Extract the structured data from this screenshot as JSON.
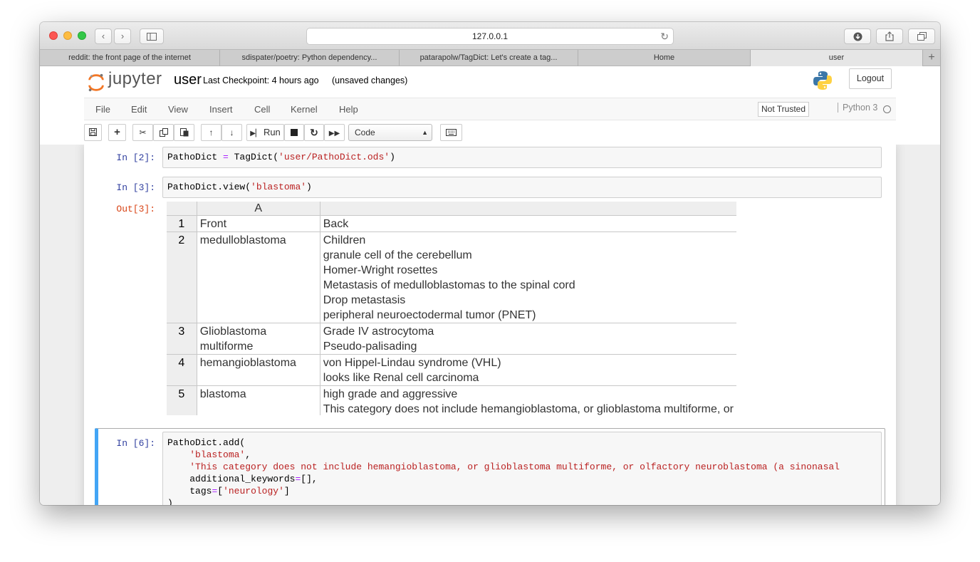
{
  "browser": {
    "url": "127.0.0.1",
    "tabs": [
      {
        "label": "reddit: the front page of the internet"
      },
      {
        "label": "sdispater/poetry: Python dependency..."
      },
      {
        "label": "patarapolw/TagDict: Let's create a tag..."
      },
      {
        "label": "Home"
      },
      {
        "label": "user"
      }
    ]
  },
  "jupyter": {
    "logo_text": "jupyter",
    "notebook_name": "user",
    "checkpoint": "Last Checkpoint: 4 hours ago",
    "unsaved": "(unsaved changes)",
    "logout": "Logout",
    "menu": [
      "File",
      "Edit",
      "View",
      "Insert",
      "Cell",
      "Kernel",
      "Help"
    ],
    "trust": "Not Trusted",
    "kernel_name": "Python 3",
    "run_label": "Run",
    "cell_type": "Code"
  },
  "cells": {
    "c2": {
      "prompt": "In [2]:",
      "code": {
        "a": "PathoDict ",
        "b": "=",
        "c": " TagDict(",
        "d": "'user/PathoDict.ods'",
        "e": ")"
      }
    },
    "c3": {
      "prompt": "In [3]:",
      "code": {
        "a": "PathoDict.view(",
        "b": "'blastoma'",
        "c": ")"
      },
      "out_prompt": "Out[3]:"
    },
    "c6": {
      "prompt": "In [6]:",
      "lines": {
        "l1": "PathoDict.add(",
        "l2": "'blastoma'",
        "l2b": ",",
        "l3": "'This category does not include hemangioblastoma, or glioblastoma multiforme, or olfactory neuroblastoma (a sinonasal",
        "l4a": "additional_keywords",
        "l4b": "=",
        "l4c": "[],",
        "l5a": "tags",
        "l5b": "=",
        "l5c": "[",
        "l5d": "'neurology'",
        "l5e": "]",
        "l6": ")"
      }
    }
  },
  "sheet": {
    "col_header": "A",
    "rows": [
      {
        "num": "1",
        "front": "Front",
        "back": [
          "Back"
        ]
      },
      {
        "num": "2",
        "front": "medulloblastoma",
        "back": [
          "Children",
          "granule cell of the cerebellum",
          "Homer-Wright rosettes",
          "Metastasis of medulloblastomas to the spinal cord",
          "Drop metastasis",
          "peripheral neuroectodermal tumor (PNET)"
        ]
      },
      {
        "num": "3",
        "front": "Glioblastoma multiforme",
        "back": [
          "Grade IV astrocytoma",
          "Pseudo-palisading"
        ]
      },
      {
        "num": "4",
        "front": "hemangioblastoma",
        "back": [
          "von Hippel-Lindau syndrome (VHL)",
          "looks like Renal cell carcinoma"
        ]
      },
      {
        "num": "5",
        "front": "blastoma",
        "back": [
          "high grade and aggressive",
          "This category does not include hemangioblastoma, or glioblastoma multiforme, or"
        ]
      }
    ]
  }
}
